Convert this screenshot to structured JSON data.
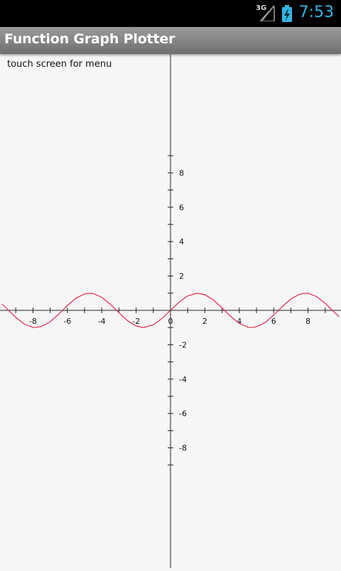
{
  "status_bar": {
    "network": "3G",
    "time": "7:53",
    "icons": [
      "signal-icon",
      "battery-charging-icon"
    ],
    "accent_color": "#33b5e5"
  },
  "app": {
    "title": "Function Graph Plotter",
    "hint": "touch screen for menu"
  },
  "chart_data": {
    "type": "line",
    "title": "",
    "xlabel": "",
    "ylabel": "",
    "xlim": [
      -9.8,
      9.8
    ],
    "ylim": [
      -9.8,
      9.8
    ],
    "x_ticks": [
      -8,
      -6,
      -4,
      -2,
      0,
      2,
      4,
      6,
      8
    ],
    "y_ticks": [
      -8,
      -6,
      -4,
      -2,
      2,
      4,
      6,
      8
    ],
    "grid": false,
    "series": [
      {
        "color": "#e0284a",
        "points": [
          [
            -9.8,
            0.37
          ],
          [
            -9.5,
            0.08
          ],
          [
            -9.0,
            -0.41
          ],
          [
            -8.5,
            -0.8
          ],
          [
            -8.0,
            -0.99
          ],
          [
            -7.85,
            -1.0
          ],
          [
            -7.5,
            -0.94
          ],
          [
            -7.0,
            -0.66
          ],
          [
            -6.5,
            -0.22
          ],
          [
            -6.28,
            0.0
          ],
          [
            -6.0,
            0.28
          ],
          [
            -5.5,
            0.71
          ],
          [
            -5.0,
            0.96
          ],
          [
            -4.71,
            1.0
          ],
          [
            -4.5,
            0.98
          ],
          [
            -4.0,
            0.76
          ],
          [
            -3.5,
            0.35
          ],
          [
            -3.14,
            0.0
          ],
          [
            -3.0,
            -0.14
          ],
          [
            -2.5,
            -0.6
          ],
          [
            -2.0,
            -0.91
          ],
          [
            -1.57,
            -1.0
          ],
          [
            -1.0,
            -0.84
          ],
          [
            -0.5,
            -0.48
          ],
          [
            0.0,
            0.0
          ],
          [
            0.5,
            0.48
          ],
          [
            1.0,
            0.84
          ],
          [
            1.57,
            1.0
          ],
          [
            2.0,
            0.91
          ],
          [
            2.5,
            0.6
          ],
          [
            3.0,
            0.14
          ],
          [
            3.14,
            0.0
          ],
          [
            3.5,
            -0.35
          ],
          [
            4.0,
            -0.76
          ],
          [
            4.5,
            -0.98
          ],
          [
            4.71,
            -1.0
          ],
          [
            5.0,
            -0.96
          ],
          [
            5.5,
            -0.71
          ],
          [
            6.0,
            -0.28
          ],
          [
            6.28,
            0.0
          ],
          [
            6.5,
            0.22
          ],
          [
            7.0,
            0.66
          ],
          [
            7.5,
            0.94
          ],
          [
            7.85,
            1.0
          ],
          [
            8.0,
            0.99
          ],
          [
            8.5,
            0.8
          ],
          [
            9.0,
            0.41
          ],
          [
            9.5,
            -0.08
          ],
          [
            9.8,
            -0.37
          ]
        ]
      }
    ]
  }
}
